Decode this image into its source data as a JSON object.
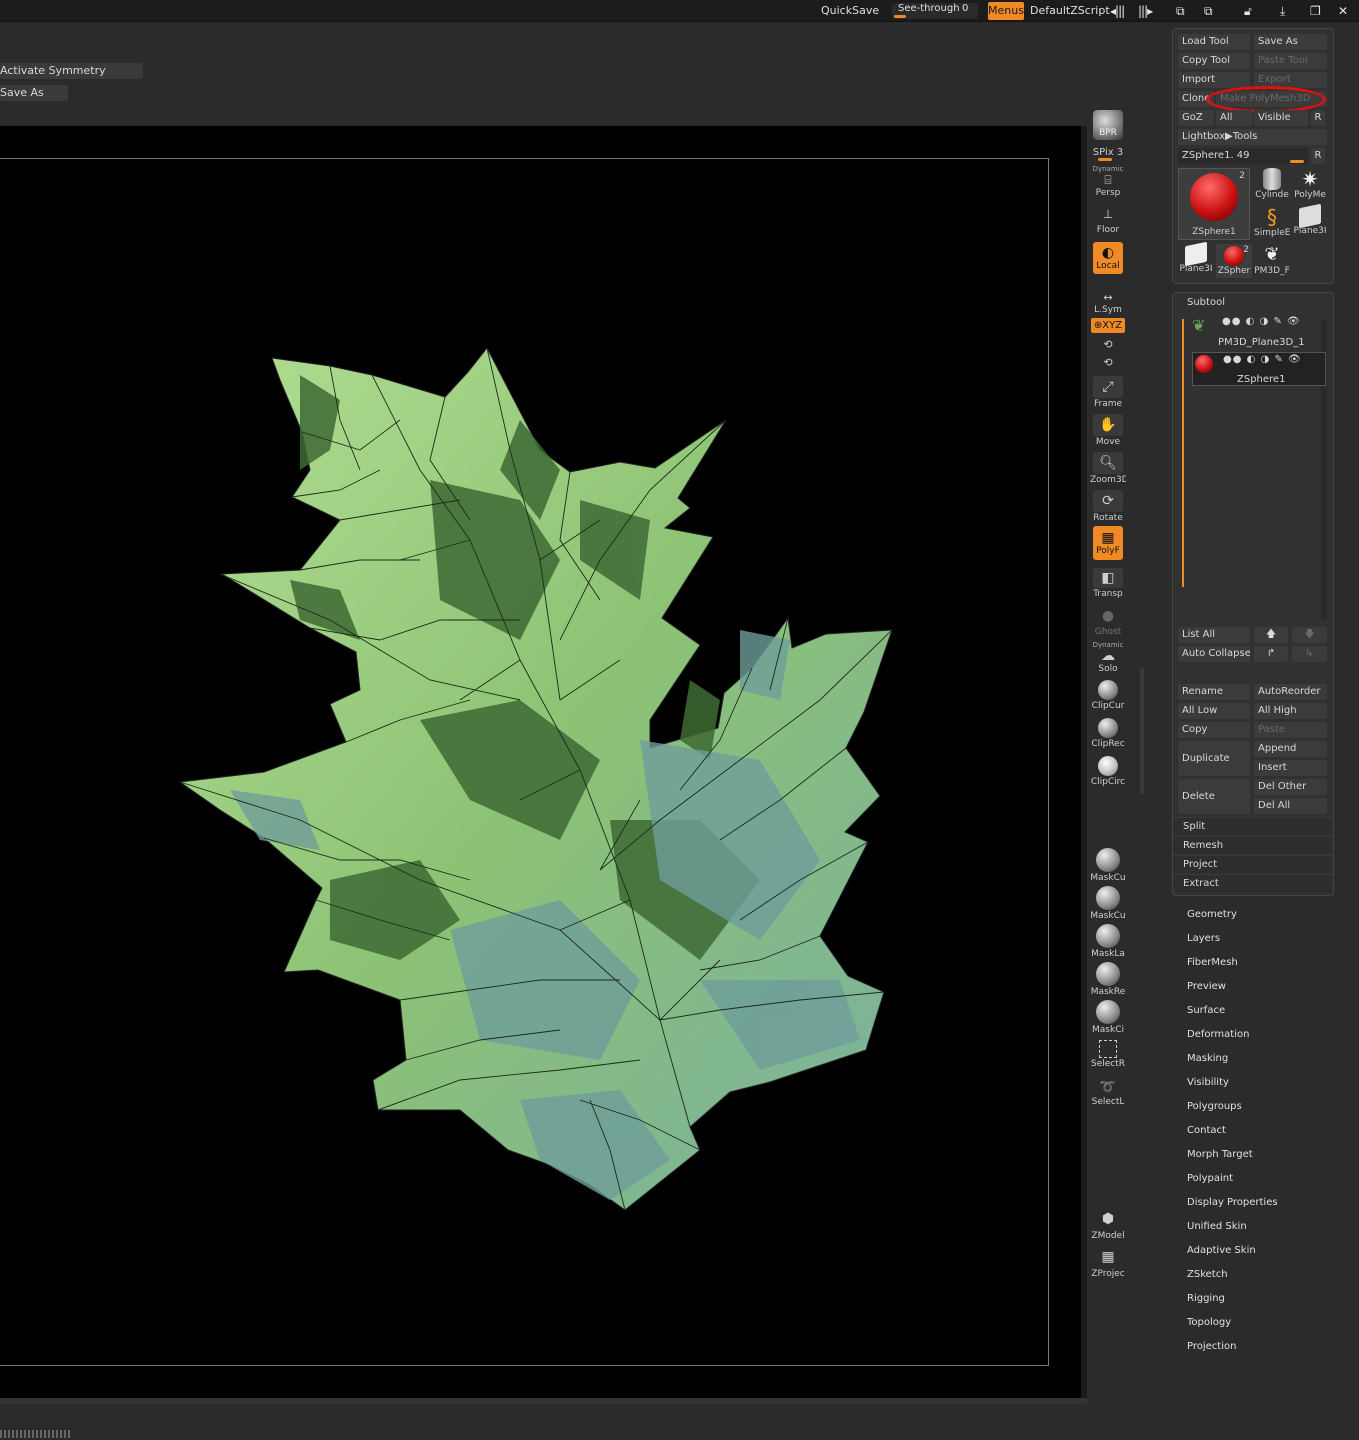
{
  "topbar": {
    "quicksave": "QuickSave",
    "seethrough_label": "See-through",
    "seethrough_value": "0",
    "menus": "Menus",
    "script": "DefaultZScript"
  },
  "left_buttons": {
    "activate_symmetry": "Activate Symmetry",
    "save_as": "Save As"
  },
  "shelf": {
    "bpr": "BPR",
    "spix_label": "SPix",
    "spix_value": "3",
    "dynamic": "Dynamic",
    "persp": "Persp",
    "floor": "Floor",
    "local": "Local",
    "lsym": "L.Sym",
    "xyz": "⊕XYZ",
    "frame": "Frame",
    "move": "Move",
    "zoom3d": "Zoom3D",
    "rotate": "Rotate",
    "polyf": "PolyF",
    "transp": "Transp",
    "ghost": "Ghost",
    "dynamic2": "Dynamic",
    "solo": "Solo",
    "clipcur": "ClipCur",
    "cliprec": "ClipRec",
    "clipcirc": "ClipCirc",
    "maskcu1": "MaskCu",
    "maskcu2": "MaskCu",
    "maskla": "MaskLa",
    "maskre": "MaskRe",
    "maskci": "MaskCi",
    "selectr": "SelectR",
    "selectl": "SelectL",
    "zmodel": "ZModel",
    "zproject": "ZProjec"
  },
  "tool_panel": {
    "load_tool": "Load Tool",
    "save_as": "Save As",
    "copy_tool": "Copy Tool",
    "paste_tool": "Paste Tool",
    "import": "Import",
    "export": "Export",
    "clone": "Clone",
    "make_polymesh": "Make PolyMesh3D",
    "goz": "GoZ",
    "all": "All",
    "visible": "Visible",
    "r": "R",
    "lightbox": "Lightbox▶Tools",
    "current_tool": "ZSphere1. 49",
    "thumbs": [
      {
        "label": "ZSphere1",
        "badge": "2"
      },
      {
        "label": "Cylinde",
        "badge": ""
      },
      {
        "label": "PolyMe",
        "badge": ""
      },
      {
        "label": "SimpleE",
        "badge": ""
      },
      {
        "label": "Plane3I",
        "badge": ""
      },
      {
        "label": "Plane3I",
        "badge": ""
      },
      {
        "label": "ZSpher",
        "badge": "2"
      },
      {
        "label": "PM3D_F",
        "badge": ""
      }
    ]
  },
  "subtool": {
    "title": "Subtool",
    "items": [
      {
        "name": "PM3D_Plane3D_1"
      },
      {
        "name": "ZSphere1"
      }
    ],
    "list_all": "List All",
    "auto_collapse": "Auto Collapse",
    "rename": "Rename",
    "autoreorder": "AutoReorder",
    "all_low": "All Low",
    "all_high": "All High",
    "copy": "Copy",
    "paste": "Paste",
    "duplicate": "Duplicate",
    "append": "Append",
    "insert": "Insert",
    "delete": "Delete",
    "del_other": "Del Other",
    "del_all": "Del All",
    "split": "Split",
    "remesh": "Remesh",
    "project": "Project",
    "extract": "Extract"
  },
  "menu": [
    "Geometry",
    "Layers",
    "FiberMesh",
    "Preview",
    "Surface",
    "Deformation",
    "Masking",
    "Visibility",
    "Polygroups",
    "Contact",
    "Morph Target",
    "Polypaint",
    "Display Properties",
    "Unified Skin",
    "Adaptive Skin",
    "ZSketch",
    "Rigging",
    "Topology",
    "Projection"
  ],
  "colors": {
    "accent": "#f08a24",
    "highlight_ellipse": "#e01010",
    "leaf_light": "#a8d88a",
    "leaf_dark": "#3c6a34"
  }
}
